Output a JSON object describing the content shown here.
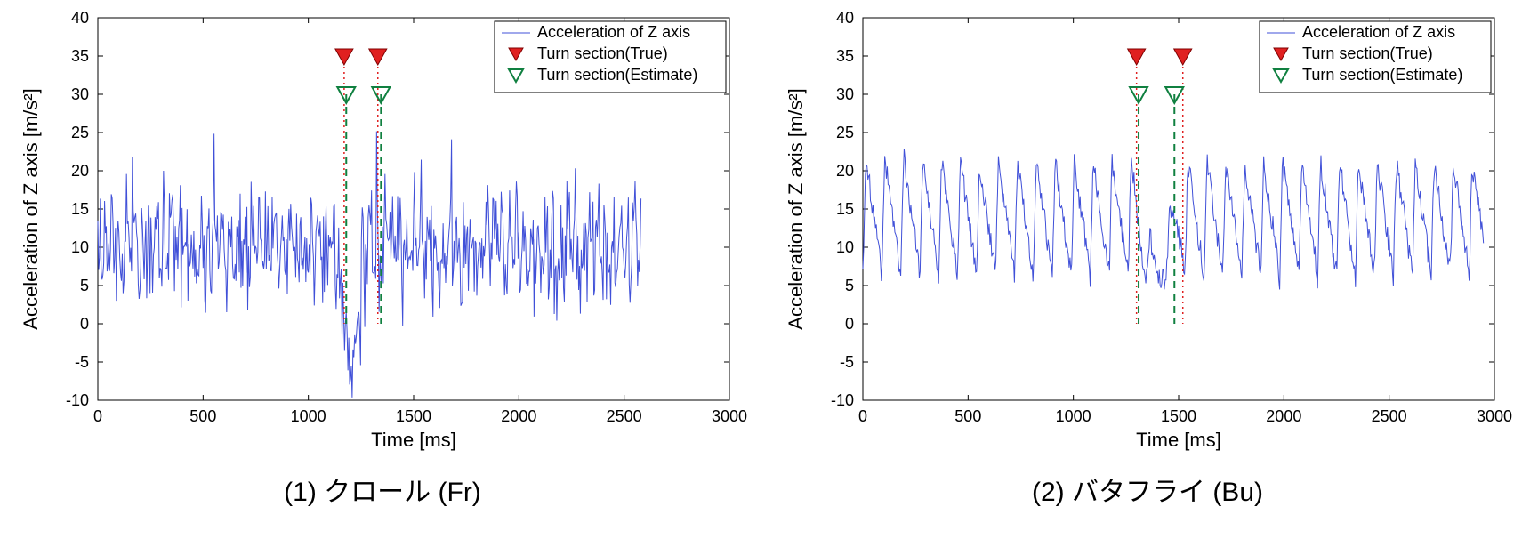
{
  "chart_data": [
    {
      "type": "line",
      "caption": "(1) クロール (Fr)",
      "xlabel": "Time [ms]",
      "ylabel": "Acceleration of Z axis [m/s²]",
      "xlim": [
        0,
        3000
      ],
      "ylim": [
        -10,
        40
      ],
      "xticks": [
        0,
        500,
        1000,
        1500,
        2000,
        2500,
        3000
      ],
      "yticks": [
        -10,
        -5,
        0,
        5,
        10,
        15,
        20,
        25,
        30,
        35,
        40
      ],
      "legend": {
        "items": [
          {
            "label": "Acceleration of Z axis",
            "type": "line",
            "color": "#4050d8"
          },
          {
            "label": "Turn section(True)",
            "type": "vtri-fill",
            "color": "#e02020"
          },
          {
            "label": "Turn section(Estimate)",
            "type": "vtri-open",
            "color": "#108040"
          }
        ]
      },
      "signal": {
        "x_end": 2580,
        "mean": 10,
        "amp_low": 5,
        "amp_high": 12,
        "noise_freq": 0.18,
        "dip_at": 1200,
        "dip_width": 120,
        "dip_min": -10
      },
      "markers_true": {
        "x": [
          1170,
          1330
        ],
        "y": 35
      },
      "markers_est": {
        "x": [
          1180,
          1345
        ],
        "y": 30
      }
    },
    {
      "type": "line",
      "caption": "(2) バタフライ (Bu)",
      "xlabel": "Time [ms]",
      "ylabel": "Acceleration of Z axis [m/s²]",
      "xlim": [
        0,
        3000
      ],
      "ylim": [
        -10,
        40
      ],
      "xticks": [
        0,
        500,
        1000,
        1500,
        2000,
        2500,
        3000
      ],
      "yticks": [
        -10,
        -5,
        0,
        5,
        10,
        15,
        20,
        25,
        30,
        35,
        40
      ],
      "legend": {
        "items": [
          {
            "label": "Acceleration of Z axis",
            "type": "line",
            "color": "#4050d8"
          },
          {
            "label": "Turn section(True)",
            "type": "vtri-fill",
            "color": "#e02020"
          },
          {
            "label": "Turn section(Estimate)",
            "type": "vtri-open",
            "color": "#108040"
          }
        ]
      },
      "signal": {
        "x_end": 2950,
        "mean": 11,
        "amp_low": 2,
        "amp_high": 28,
        "cycle": 90,
        "shape": "butterfly",
        "dip_at": 1400,
        "dip_width": 220,
        "dip_min": -2
      },
      "markers_true": {
        "x": [
          1300,
          1520
        ],
        "y": 35
      },
      "markers_est": {
        "x": [
          1310,
          1480
        ],
        "y": 30
      }
    }
  ]
}
